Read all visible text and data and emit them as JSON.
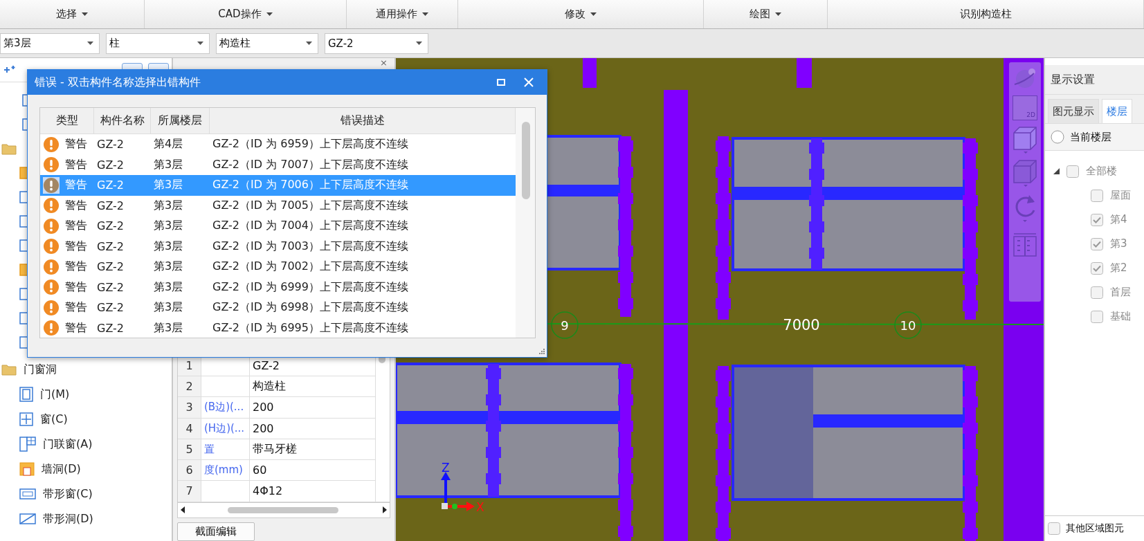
{
  "toolbar": {
    "groups": [
      {
        "label": "选择",
        "dropdown": true
      },
      {
        "label": "CAD操作",
        "dropdown": true
      },
      {
        "label": "通用操作",
        "dropdown": true
      },
      {
        "label": "修改",
        "dropdown": true
      },
      {
        "label": "绘图",
        "dropdown": true
      },
      {
        "label": "识别构造柱",
        "dropdown": false
      }
    ]
  },
  "selectors": [
    {
      "value": "第3层"
    },
    {
      "value": "柱"
    },
    {
      "value": "构造柱"
    },
    {
      "value": "GZ-2"
    }
  ],
  "component_tree": {
    "folder": {
      "label": "门窗洞",
      "expanded": true
    },
    "items": [
      {
        "label": "门(M)",
        "kind": "door"
      },
      {
        "label": "窗(C)",
        "kind": "window"
      },
      {
        "label": "门联窗(A)",
        "kind": "doorwindow"
      },
      {
        "label": "墙洞(D)",
        "kind": "opening"
      },
      {
        "label": "带形窗(C)",
        "kind": "stripwindow"
      },
      {
        "label": "带形洞(D)",
        "kind": "stripopening"
      }
    ]
  },
  "property_grid": {
    "close": "×",
    "rows": [
      {
        "number": "1",
        "value": "GZ-2"
      },
      {
        "number": "2",
        "value": "构造柱"
      },
      {
        "number": "3",
        "name": "(B边)(...",
        "value": "200"
      },
      {
        "number": "4",
        "name": "(H边)(...",
        "value": "200"
      },
      {
        "number": "5",
        "name": "置",
        "value": "带马牙槎"
      },
      {
        "number": "6",
        "name": "度(mm)",
        "value": "60"
      },
      {
        "number": "7",
        "value": "4Φ12"
      }
    ],
    "button": "截面编辑"
  },
  "canvas": {
    "axes": [
      {
        "label": "9"
      },
      {
        "label": "10"
      }
    ],
    "dimension": "7000",
    "triad": {
      "z": "Z",
      "x": "X"
    },
    "view_toolbar": {
      "two_d": "2D"
    }
  },
  "display_panel": {
    "title": "显示设置",
    "tabs": [
      {
        "label": "图元显示",
        "selected": false
      },
      {
        "label": "楼层",
        "selected": true
      }
    ],
    "radios": [
      {
        "label": "当前楼层",
        "selected": false
      }
    ],
    "floor_tree": {
      "label": "全部楼",
      "checked": false,
      "expanded": true,
      "children": [
        {
          "label": "屋面",
          "checked": false
        },
        {
          "label": "第4",
          "checked": true
        },
        {
          "label": "第3",
          "checked": true
        },
        {
          "label": "第2",
          "checked": true
        },
        {
          "label": "首层",
          "checked": false
        },
        {
          "label": "基础",
          "checked": false
        }
      ]
    },
    "footer_checkbox": {
      "label": "其他区域图元",
      "checked": false
    }
  },
  "dialog": {
    "title": "错误 - 双击构件名称选择出错构件",
    "columns": [
      "类型",
      "构件名称",
      "所属楼层",
      "错误描述"
    ],
    "rows": [
      {
        "type": "警告",
        "name": "GZ-2",
        "floor": "第4层",
        "description": "GZ-2（ID 为 6959）上下层高度不连续",
        "selected": false
      },
      {
        "type": "警告",
        "name": "GZ-2",
        "floor": "第3层",
        "description": "GZ-2（ID 为 7007）上下层高度不连续",
        "selected": false
      },
      {
        "type": "警告",
        "name": "GZ-2",
        "floor": "第3层",
        "description": "GZ-2（ID 为 7006）上下层高度不连续",
        "selected": true
      },
      {
        "type": "警告",
        "name": "GZ-2",
        "floor": "第3层",
        "description": "GZ-2（ID 为 7005）上下层高度不连续",
        "selected": false
      },
      {
        "type": "警告",
        "name": "GZ-2",
        "floor": "第3层",
        "description": "GZ-2（ID 为 7004）上下层高度不连续",
        "selected": false
      },
      {
        "type": "警告",
        "name": "GZ-2",
        "floor": "第3层",
        "description": "GZ-2（ID 为 7003）上下层高度不连续",
        "selected": false
      },
      {
        "type": "警告",
        "name": "GZ-2",
        "floor": "第3层",
        "description": "GZ-2（ID 为 7002）上下层高度不连续",
        "selected": false
      },
      {
        "type": "警告",
        "name": "GZ-2",
        "floor": "第3层",
        "description": "GZ-2（ID 为 6999）上下层高度不连续",
        "selected": false
      },
      {
        "type": "警告",
        "name": "GZ-2",
        "floor": "第3层",
        "description": "GZ-2（ID 为 6998）上下层高度不连续",
        "selected": false
      },
      {
        "type": "警告",
        "name": "GZ-2",
        "floor": "第3层",
        "description": "GZ-2（ID 为 6995）上下层高度不连续",
        "selected": false
      }
    ]
  }
}
